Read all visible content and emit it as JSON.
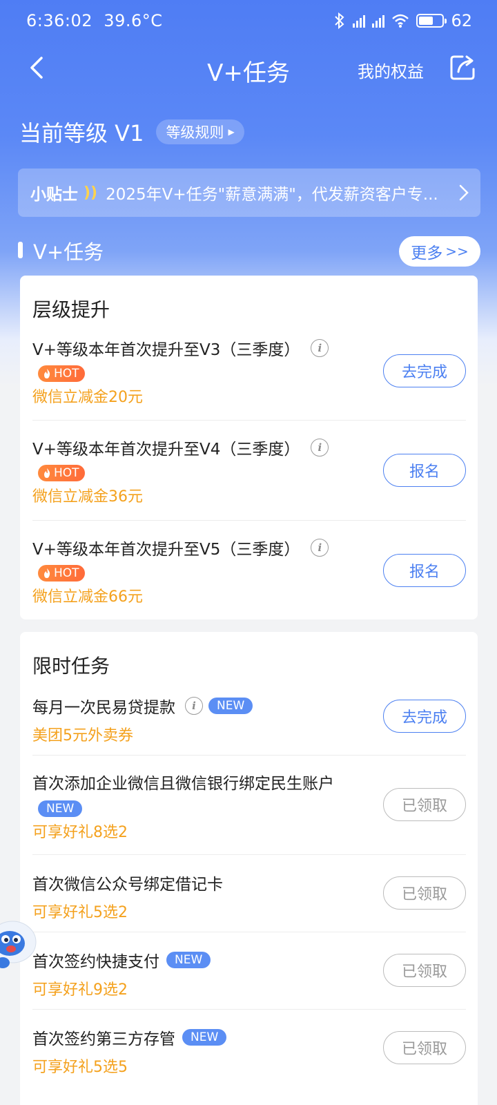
{
  "status_bar": {
    "time": "6:36:02",
    "temperature": "39.6°C",
    "battery": "62",
    "battery_level": 0.62
  },
  "nav": {
    "title": "V+任务",
    "benefits_label": "我的权益"
  },
  "level": {
    "label": "当前等级 V1",
    "rules_label": "等级规则"
  },
  "tip": {
    "label": "小贴士",
    "text": "2025年V+任务\"薪意满满\"，代发薪资客户专..."
  },
  "section": {
    "title": "V+任务",
    "more_label": "更多"
  },
  "level_up": {
    "title": "层级提升",
    "tasks": [
      {
        "name": "V+等级本年首次提升至V3（三季度）",
        "badge": "HOT",
        "reward": "微信立减金20元",
        "button": "去完成"
      },
      {
        "name": "V+等级本年首次提升至V4（三季度）",
        "badge": "HOT",
        "reward": "微信立减金36元",
        "button": "报名"
      },
      {
        "name": "V+等级本年首次提升至V5（三季度）",
        "badge": "HOT",
        "reward": "微信立减金66元",
        "button": "报名"
      }
    ]
  },
  "limited": {
    "title": "限时任务",
    "tasks": [
      {
        "name": "每月一次民易贷提款",
        "badge": "NEW",
        "reward": "美团5元外卖券",
        "button": "去完成"
      },
      {
        "name": "首次添加企业微信且微信银行绑定民生账户",
        "badge": "NEW",
        "reward": "可享好礼8选2",
        "button": "已领取"
      },
      {
        "name": "首次微信公众号绑定借记卡",
        "reward": "可享好礼5选2",
        "button": "已领取"
      },
      {
        "name": "首次签约快捷支付",
        "badge": "NEW",
        "reward": "可享好礼9选2",
        "button": "已领取"
      },
      {
        "name": "首次签约第三方存管",
        "badge": "NEW",
        "reward": "可享好礼5选5",
        "button": "已领取"
      }
    ]
  },
  "colors": {
    "primary": "#4c80f1",
    "reward": "#f4a11d",
    "hot": "#ff6b3a",
    "new": "#5b8ef4"
  }
}
